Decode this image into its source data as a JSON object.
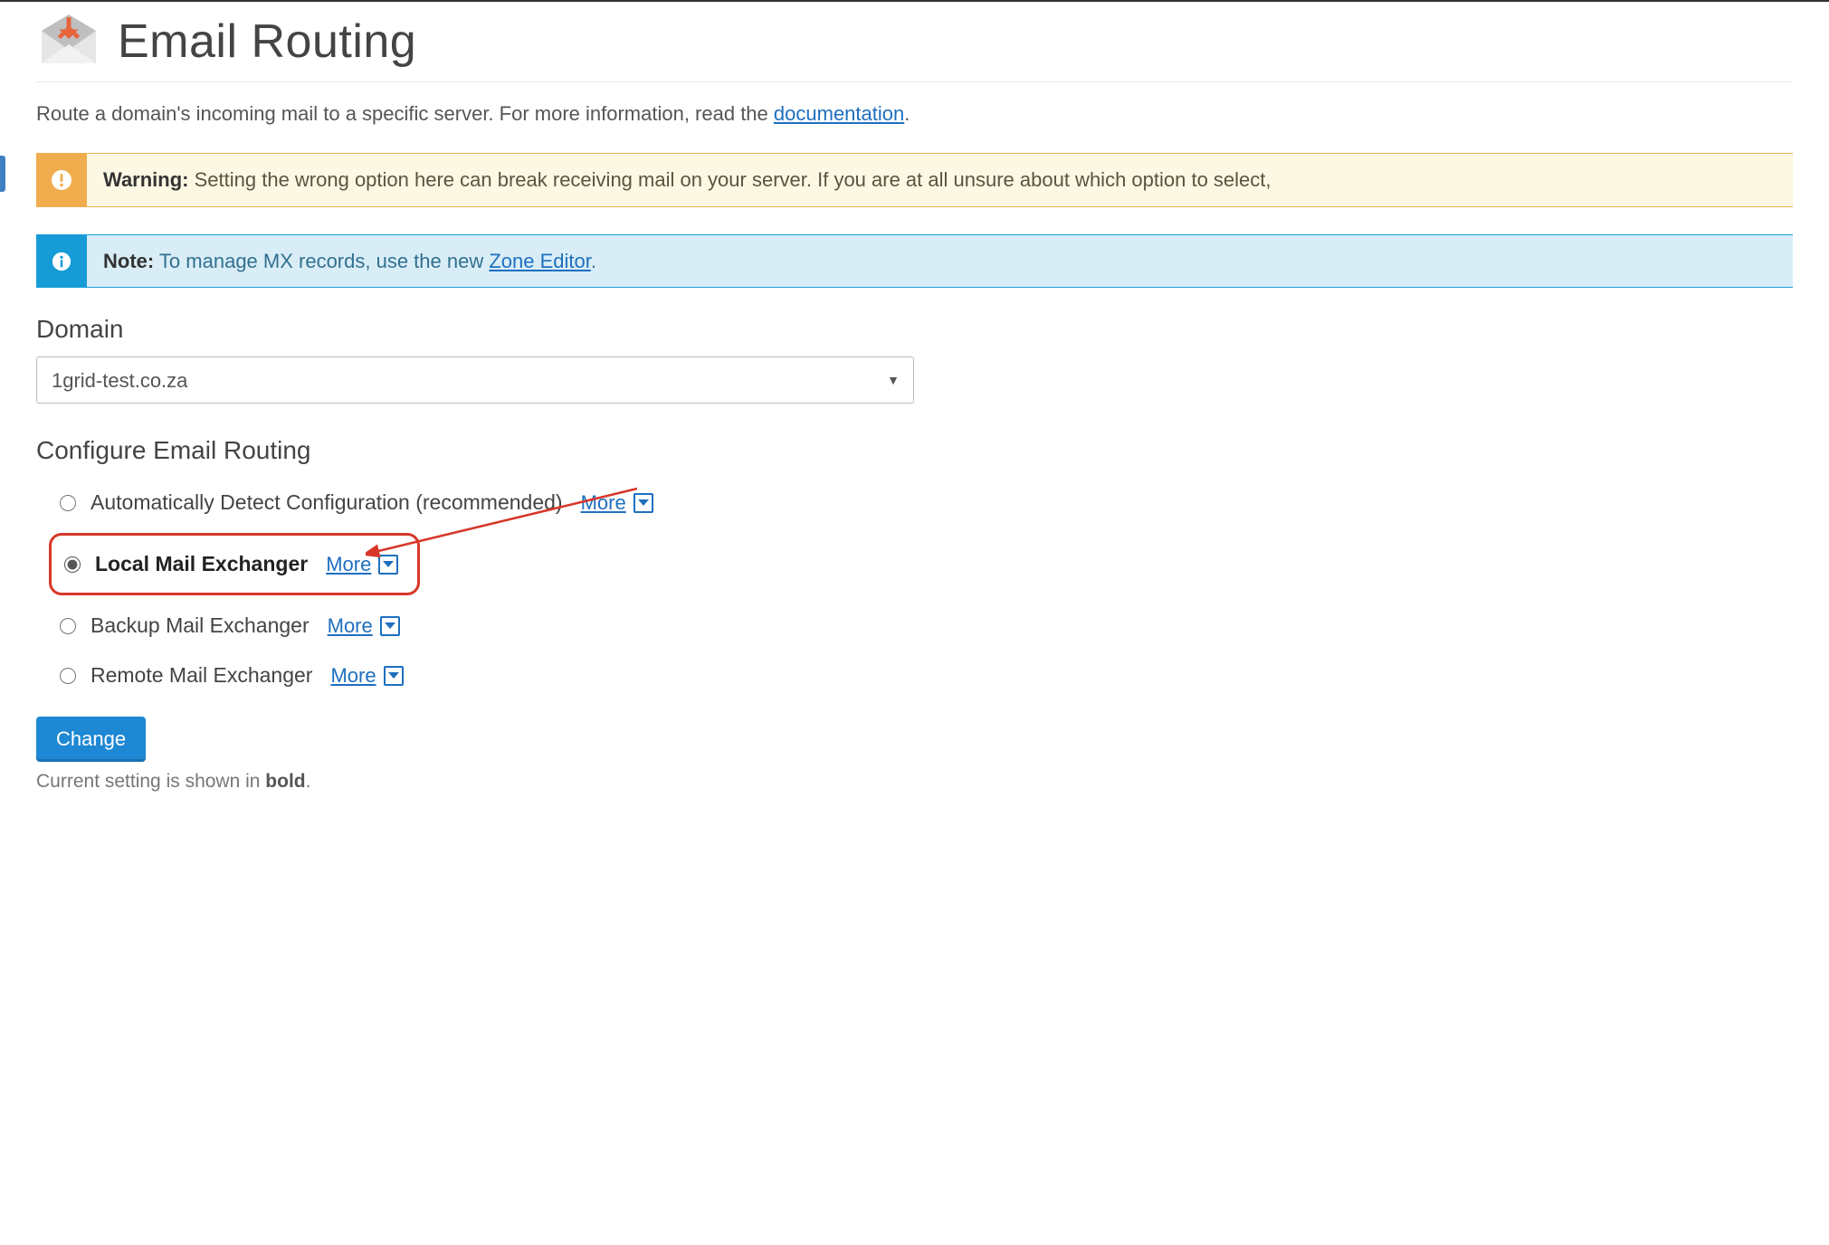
{
  "header": {
    "title": "Email Routing"
  },
  "intro": {
    "prefix": "Route a domain's incoming mail to a specific server. For more information, read the ",
    "link": "documentation",
    "suffix": "."
  },
  "alerts": {
    "warning": {
      "label": "Warning:",
      "text": " Setting the wrong option here can break receiving mail on your server. If you are at all unsure about which option to select,"
    },
    "info": {
      "label": "Note:",
      "prefix": " To manage MX records, use the new ",
      "link": "Zone Editor",
      "suffix": "."
    }
  },
  "domain": {
    "label": "Domain",
    "selected": "1grid-test.co.za"
  },
  "routing": {
    "label": "Configure Email Routing",
    "more_label": "More",
    "options": [
      {
        "label": "Automatically Detect Configuration (recommended)",
        "checked": false,
        "bold": false
      },
      {
        "label": "Local Mail Exchanger",
        "checked": true,
        "bold": true
      },
      {
        "label": "Backup Mail Exchanger",
        "checked": false,
        "bold": false
      },
      {
        "label": "Remote Mail Exchanger",
        "checked": false,
        "bold": false
      }
    ],
    "change_label": "Change",
    "hint_prefix": "Current setting is shown in ",
    "hint_bold": "bold",
    "hint_suffix": "."
  }
}
